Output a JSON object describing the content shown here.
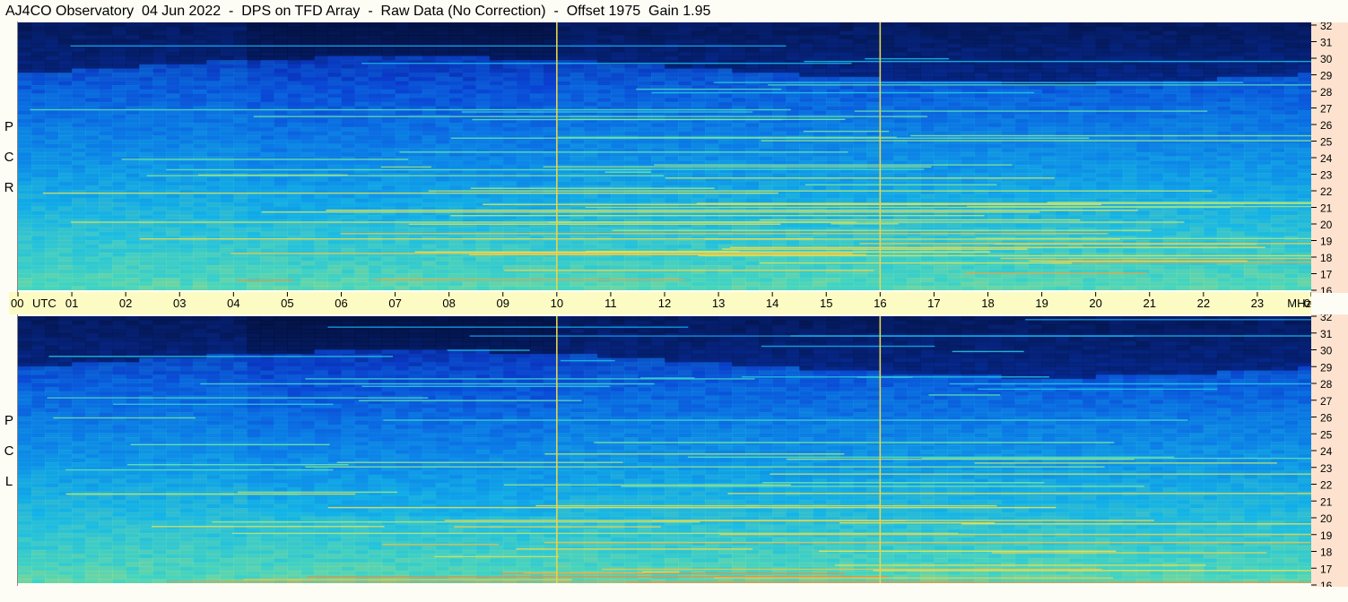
{
  "header": {
    "title": "AJ4CO Observatory  04 Jun 2022  -  DPS on TFD Array  -  Raw Data (No Correction)  -  Offset 1975  Gain 1.95"
  },
  "panels": [
    {
      "polarization": "RCP",
      "letters": [
        "P",
        "C",
        "R"
      ]
    },
    {
      "polarization": "LCP",
      "letters": [
        "P",
        "C",
        "L"
      ]
    }
  ],
  "chart_data": {
    "type": "heatmap",
    "title": "AJ4CO Observatory  04 Jun 2022  -  DPS on TFD Array  -  Raw Data (No Correction)  -  Offset 1975  Gain 1.95",
    "x_axis": {
      "unit_label": "UTC",
      "ticks": [
        "00",
        "01",
        "02",
        "03",
        "04",
        "05",
        "06",
        "07",
        "08",
        "09",
        "10",
        "11",
        "12",
        "13",
        "14",
        "15",
        "16",
        "17",
        "18",
        "19",
        "20",
        "21",
        "22",
        "23",
        "00"
      ],
      "range_hours": [
        0,
        24
      ]
    },
    "y_axis": {
      "unit_label": "MHz",
      "ticks": [
        "16",
        "17",
        "18",
        "19",
        "20",
        "21",
        "22",
        "23",
        "24",
        "25",
        "26",
        "27",
        "28",
        "29",
        "30",
        "31",
        "32"
      ],
      "range": [
        16,
        32
      ]
    },
    "series": [
      {
        "name": "RCP",
        "description_level": "raw spectrogram intensity"
      },
      {
        "name": "LCP",
        "description_level": "raw spectrogram intensity"
      }
    ],
    "markers_hours": [
      10,
      16
    ],
    "colormap": [
      "#000d33",
      "#0b3fd9",
      "#0c8ef0",
      "#19c8e8",
      "#6ee6a8",
      "#f5e34a",
      "#f0803a"
    ]
  }
}
